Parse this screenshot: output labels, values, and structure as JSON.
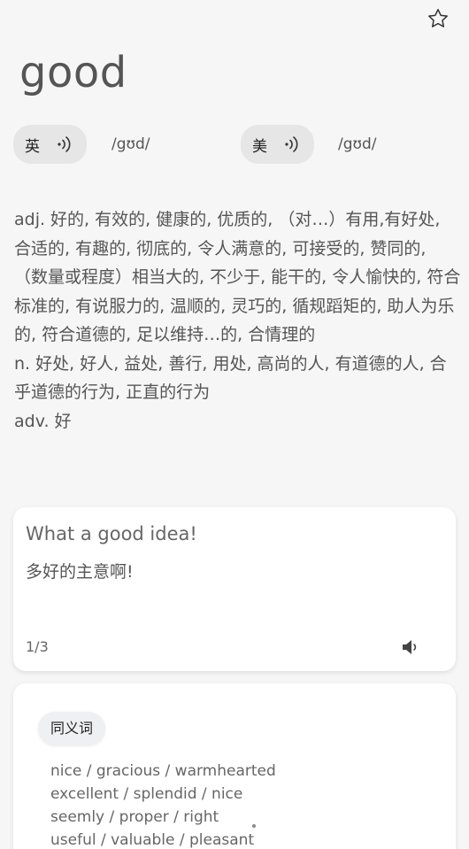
{
  "word": "good",
  "pronunciations": [
    {
      "label": "英",
      "phonetic": "/gʊd/"
    },
    {
      "label": "美",
      "phonetic": "/gʊd/"
    }
  ],
  "definitions": [
    "adj. 好的, 有效的, 健康的, 优质的, （对…）有用,有好处, 合适的, 有趣的, 彻底的, 令人满意的, 可接受的, 赞同的, （数量或程度）相当大的, 不少于, 能干的, 令人愉快的, 符合标准的, 有说服力的, 温顺的, 灵巧的, 循规蹈矩的, 助人为乐的, 符合道德的, 足以维持…的, 合情理的",
    "n. 好处, 好人, 益处, 善行, 用处, 高尚的人, 有道德的人, 合乎道德的行为, 正直的行为",
    "adv. 好"
  ],
  "example": {
    "english": "What a good idea!",
    "chinese": "多好的主意啊!",
    "counter": "1/3"
  },
  "synonyms": {
    "tag": "同义词",
    "lines": [
      "nice / gracious / warmhearted",
      "excellent / splendid / nice",
      "seemly / proper / right",
      "useful / valuable / pleasant"
    ]
  },
  "icons": {
    "favorite": "star-icon",
    "pronounce": "speaker-wave-icon",
    "example_audio": "speaker-icon"
  }
}
